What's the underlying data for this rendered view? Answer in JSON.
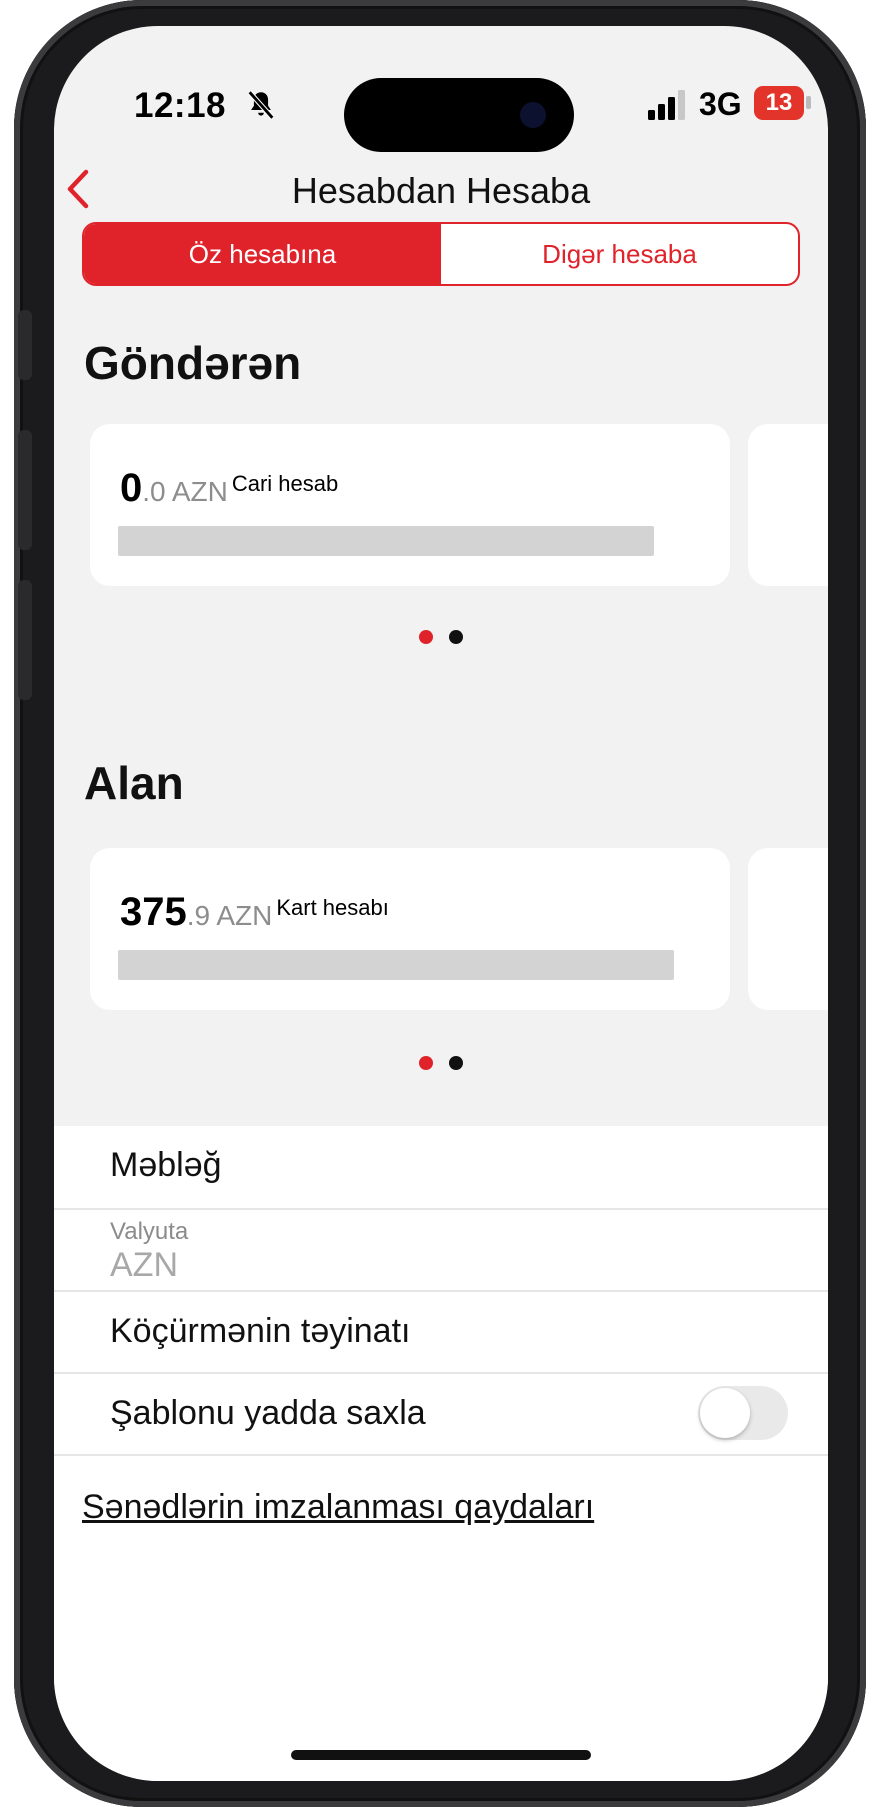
{
  "status_bar": {
    "time": "12:18",
    "network": "3G",
    "battery": "13"
  },
  "nav": {
    "title": "Hesabdan Hesaba"
  },
  "segments": {
    "own": "Öz hesabına",
    "other": "Digər hesaba"
  },
  "sender": {
    "title": "Göndərən",
    "card": {
      "amount_int": "0",
      "amount_dec": ".0 AZN",
      "account_type": "Cari hesab"
    },
    "pager": {
      "pages": 2,
      "active": 1
    }
  },
  "receiver": {
    "title": "Alan",
    "card": {
      "amount_int": "375",
      "amount_dec": ".9 AZN",
      "account_type": "Kart hesabı"
    },
    "pager": {
      "pages": 2,
      "active": 1
    }
  },
  "form": {
    "amount_label": "Məbləğ",
    "currency_label": "Valyuta",
    "currency_value": "AZN",
    "purpose_label": "Köçürmənin təyinatı",
    "save_template_label": "Şablonu yadda saxla",
    "save_template_on": false
  },
  "footer": {
    "rules_link": "Sənədlərin imzalanması qaydaları"
  },
  "colors": {
    "accent": "#e0232b",
    "background": "#f2f2f2",
    "card": "#ffffff"
  }
}
